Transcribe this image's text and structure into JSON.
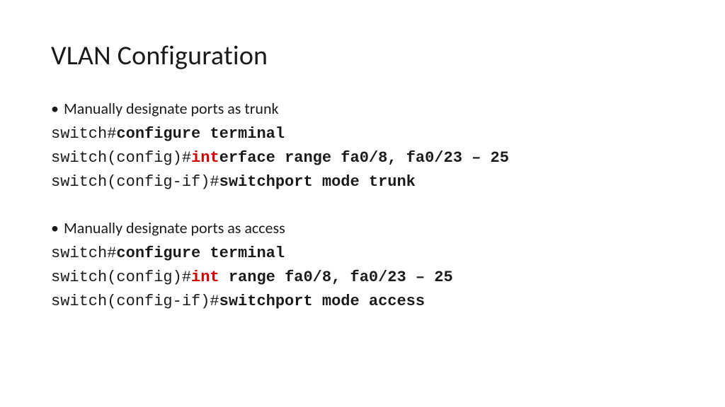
{
  "title": "VLAN Configuration",
  "blocks": [
    {
      "bullet": "Manually designate ports as trunk",
      "lines": [
        {
          "parts": [
            {
              "t": "switch#",
              "cls": "prompt"
            },
            {
              "t": "configure terminal",
              "cls": "cmd-bold"
            }
          ]
        },
        {
          "parts": [
            {
              "t": "switch(config)#",
              "cls": "prompt"
            },
            {
              "t": "int",
              "cls": "cmd-red"
            },
            {
              "t": "erface range fa0/8, fa0/23 – 25",
              "cls": "cmd-bold"
            }
          ]
        },
        {
          "parts": [
            {
              "t": "switch(config-if)#",
              "cls": "prompt"
            },
            {
              "t": "switchport mode trunk",
              "cls": "cmd-bold"
            }
          ]
        }
      ]
    },
    {
      "bullet": "Manually designate ports as access",
      "lines": [
        {
          "parts": [
            {
              "t": "switch#",
              "cls": "prompt"
            },
            {
              "t": "configure terminal",
              "cls": "cmd-bold"
            }
          ]
        },
        {
          "parts": [
            {
              "t": "switch(config)#",
              "cls": "prompt"
            },
            {
              "t": "int",
              "cls": "cmd-red"
            },
            {
              "t": " range fa0/8, fa0/23 – 25",
              "cls": "cmd-bold"
            }
          ]
        },
        {
          "parts": [
            {
              "t": "switch(config-if)#",
              "cls": "prompt"
            },
            {
              "t": "switchport mode access",
              "cls": "cmd-bold"
            }
          ]
        }
      ]
    }
  ]
}
